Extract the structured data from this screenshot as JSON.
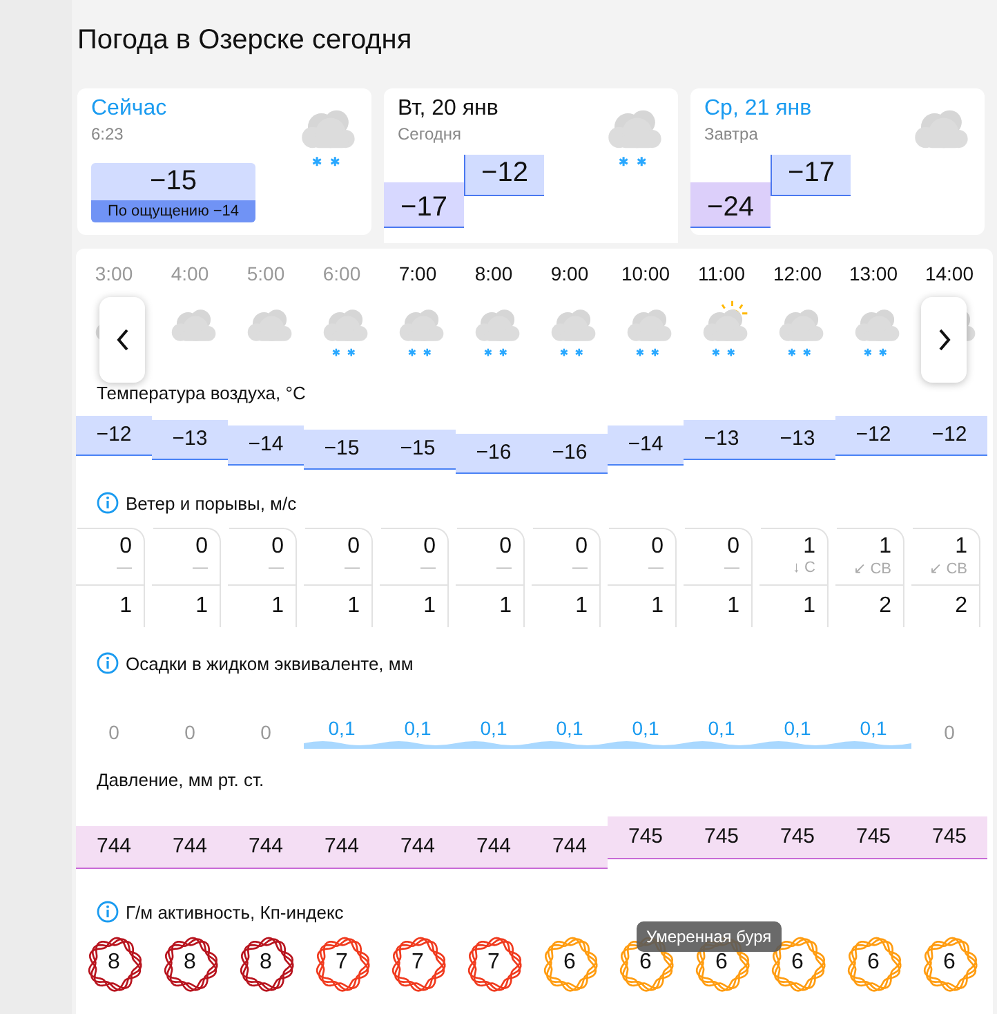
{
  "title": "Погода в Озерске сегодня",
  "days": [
    {
      "kind": "now",
      "title": "Сейчас",
      "subtitle": "6:23",
      "selected": false,
      "snow": true,
      "temp": "−15",
      "feels": "По ощущению −14"
    },
    {
      "kind": "day",
      "title": "Вт, 20 янв",
      "subtitle": "Сегодня",
      "selected": true,
      "snow": true,
      "night": "−17",
      "day": "−12"
    },
    {
      "kind": "day",
      "title": "Ср, 21 янв",
      "subtitle": "Завтра",
      "selected": false,
      "snow": false,
      "night": "−24",
      "day": "−17"
    }
  ],
  "hours": [
    {
      "time": "3:00",
      "past": true,
      "snow": false,
      "sun": false
    },
    {
      "time": "4:00",
      "past": true,
      "snow": false,
      "sun": false
    },
    {
      "time": "5:00",
      "past": true,
      "snow": false,
      "sun": false
    },
    {
      "time": "6:00",
      "past": true,
      "snow": true,
      "sun": false
    },
    {
      "time": "7:00",
      "past": false,
      "snow": true,
      "sun": false
    },
    {
      "time": "8:00",
      "past": false,
      "snow": true,
      "sun": false
    },
    {
      "time": "9:00",
      "past": false,
      "snow": true,
      "sun": false
    },
    {
      "time": "10:00",
      "past": false,
      "snow": true,
      "sun": false
    },
    {
      "time": "11:00",
      "past": false,
      "snow": true,
      "sun": true
    },
    {
      "time": "12:00",
      "past": false,
      "snow": true,
      "sun": false
    },
    {
      "time": "13:00",
      "past": false,
      "snow": true,
      "sun": false
    },
    {
      "time": "14:00",
      "past": false
    }
  ],
  "temperature": {
    "label": "Температура воздуха, °C",
    "values": [
      "−12",
      "−13",
      "−14",
      "−15",
      "−15",
      "−16",
      "−16",
      "−14",
      "−13",
      "−13",
      "−12",
      "−12"
    ]
  },
  "wind": {
    "label": "Ветер и порывы, м/с",
    "values": [
      {
        "speed": "0",
        "direction": "—",
        "gust": "1"
      },
      {
        "speed": "0",
        "direction": "—",
        "gust": "1"
      },
      {
        "speed": "0",
        "direction": "—",
        "gust": "1"
      },
      {
        "speed": "0",
        "direction": "—",
        "gust": "1"
      },
      {
        "speed": "0",
        "direction": "—",
        "gust": "1"
      },
      {
        "speed": "0",
        "direction": "—",
        "gust": "1"
      },
      {
        "speed": "0",
        "direction": "—",
        "gust": "1"
      },
      {
        "speed": "0",
        "direction": "—",
        "gust": "1"
      },
      {
        "speed": "0",
        "direction": "—",
        "gust": "1"
      },
      {
        "speed": "1",
        "direction": "↓ С",
        "gust": "1"
      },
      {
        "speed": "1",
        "direction": "↙ СВ",
        "gust": "2"
      },
      {
        "speed": "1",
        "direction": "↙ СВ",
        "gust": "2"
      }
    ]
  },
  "precipitation": {
    "label": "Осадки в жидком эквиваленте, мм",
    "values": [
      {
        "text": "0",
        "wet": false
      },
      {
        "text": "0",
        "wet": false
      },
      {
        "text": "0",
        "wet": false
      },
      {
        "text": "0,1",
        "wet": true
      },
      {
        "text": "0,1",
        "wet": true
      },
      {
        "text": "0,1",
        "wet": true
      },
      {
        "text": "0,1",
        "wet": true
      },
      {
        "text": "0,1",
        "wet": true
      },
      {
        "text": "0,1",
        "wet": true
      },
      {
        "text": "0,1",
        "wet": true
      },
      {
        "text": "0,1",
        "wet": true
      },
      {
        "text": "0",
        "wet": false
      }
    ]
  },
  "pressure": {
    "label": "Давление, мм рт. ст.",
    "values": [
      "744",
      "744",
      "744",
      "744",
      "744",
      "744",
      "744",
      "745",
      "745",
      "745",
      "745",
      "745"
    ]
  },
  "geomagnetic": {
    "label": "Г/м активность, Кп-индекс",
    "tooltip": "Умеренная буря",
    "values": [
      {
        "text": "8",
        "color": "#b8141e"
      },
      {
        "text": "8",
        "color": "#b8141e"
      },
      {
        "text": "8",
        "color": "#b8141e"
      },
      {
        "text": "7",
        "color": "#f03a1e"
      },
      {
        "text": "7",
        "color": "#f03a1e"
      },
      {
        "text": "7",
        "color": "#f03a1e"
      },
      {
        "text": "6",
        "color": "#ff9c10"
      },
      {
        "text": "6",
        "color": "#ff9c10"
      },
      {
        "text": "6",
        "color": "#ff9c10"
      },
      {
        "text": "6",
        "color": "#ff9c10"
      },
      {
        "text": "6",
        "color": "#ff9c10"
      },
      {
        "text": "6",
        "color": "#ff9c10"
      }
    ]
  }
}
